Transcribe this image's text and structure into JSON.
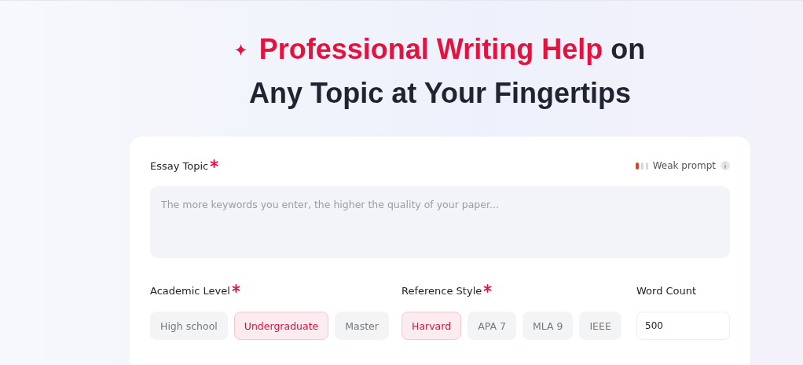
{
  "heading": {
    "highlight": "Professional Writing Help",
    "rest_line1": "on",
    "line2": "Any Topic at Your Fingertips"
  },
  "topic": {
    "label": "Essay Topic",
    "required": true,
    "strength": {
      "label": "Weak prompt",
      "level": 0.33
    },
    "placeholder": "The more keywords you enter, the higher the quality of your paper..."
  },
  "academic_level": {
    "label": "Academic Level",
    "required": true,
    "options": [
      {
        "label": "High school",
        "selected": false
      },
      {
        "label": "Undergraduate",
        "selected": true
      },
      {
        "label": "Master",
        "selected": false
      }
    ]
  },
  "reference_style": {
    "label": "Reference Style",
    "required": true,
    "options": [
      {
        "label": "Harvard",
        "selected": true
      },
      {
        "label": "APA 7",
        "selected": false
      },
      {
        "label": "MLA 9",
        "selected": false
      },
      {
        "label": "IEEE",
        "selected": false
      }
    ]
  },
  "word_count": {
    "label": "Word Count",
    "required": false,
    "value": "500"
  }
}
